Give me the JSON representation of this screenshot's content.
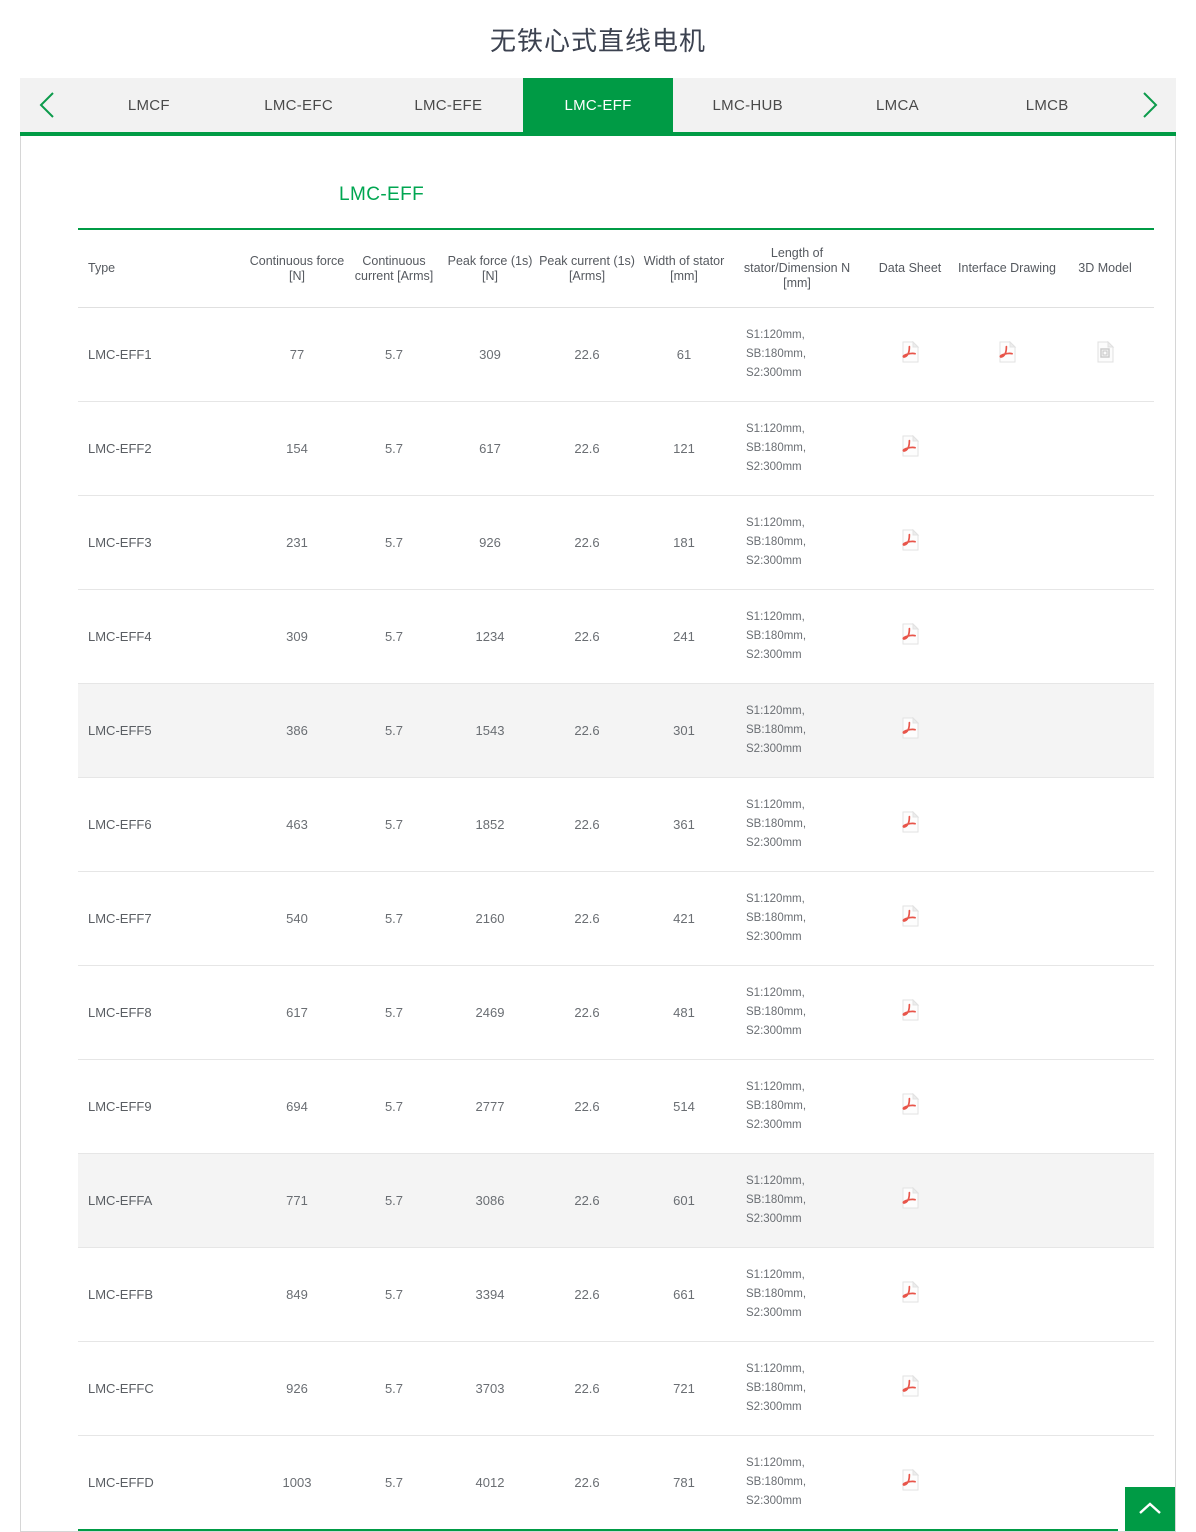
{
  "page": {
    "title": "无铁心式直线电机",
    "accent_color": "#009b45",
    "title_color": "#3c4250"
  },
  "tabs": {
    "prev_label": "‹",
    "next_label": "›",
    "items": [
      {
        "label": "LMCF",
        "active": false
      },
      {
        "label": "LMC-EFC",
        "active": false
      },
      {
        "label": "LMC-EFE",
        "active": false
      },
      {
        "label": "LMC-EFF",
        "active": true
      },
      {
        "label": "LMC-HUB",
        "active": false
      },
      {
        "label": "LMCA",
        "active": false
      },
      {
        "label": "LMCB",
        "active": false
      }
    ]
  },
  "section": {
    "title": "LMC-EFF"
  },
  "table": {
    "headers": [
      "Type",
      "Continuous force [N]",
      "Continuous current [Arms]",
      "Peak force (1s) [N]",
      "Peak current (1s) [Arms]",
      "Width of stator [mm]",
      "Length of stator/Dimension N [mm]",
      "Data Sheet",
      "Interface Drawing",
      "3D Model"
    ],
    "rows": [
      {
        "type": "LMC-EFF1",
        "continuous_force": "77",
        "continuous_current": "5.7",
        "peak_force": "309",
        "peak_current": "22.6",
        "width_of_stator": "61",
        "length_of_stator": "S1:120mm, SB:180mm, S2:300mm",
        "data_sheet": "pdf-icon",
        "interface_drawing": "pdf-icon",
        "model_3d": "model-icon",
        "alt": false
      },
      {
        "type": "LMC-EFF2",
        "continuous_force": "154",
        "continuous_current": "5.7",
        "peak_force": "617",
        "peak_current": "22.6",
        "width_of_stator": "121",
        "length_of_stator": "S1:120mm, SB:180mm, S2:300mm",
        "data_sheet": "pdf-icon",
        "interface_drawing": "",
        "model_3d": "",
        "alt": false
      },
      {
        "type": "LMC-EFF3",
        "continuous_force": "231",
        "continuous_current": "5.7",
        "peak_force": "926",
        "peak_current": "22.6",
        "width_of_stator": "181",
        "length_of_stator": "S1:120mm, SB:180mm, S2:300mm",
        "data_sheet": "pdf-icon",
        "interface_drawing": "",
        "model_3d": "",
        "alt": false
      },
      {
        "type": "LMC-EFF4",
        "continuous_force": "309",
        "continuous_current": "5.7",
        "peak_force": "1234",
        "peak_current": "22.6",
        "width_of_stator": "241",
        "length_of_stator": "S1:120mm, SB:180mm, S2:300mm",
        "data_sheet": "pdf-icon",
        "interface_drawing": "",
        "model_3d": "",
        "alt": false
      },
      {
        "type": "LMC-EFF5",
        "continuous_force": "386",
        "continuous_current": "5.7",
        "peak_force": "1543",
        "peak_current": "22.6",
        "width_of_stator": "301",
        "length_of_stator": "S1:120mm, SB:180mm, S2:300mm",
        "data_sheet": "pdf-icon",
        "interface_drawing": "",
        "model_3d": "",
        "alt": true
      },
      {
        "type": "LMC-EFF6",
        "continuous_force": "463",
        "continuous_current": "5.7",
        "peak_force": "1852",
        "peak_current": "22.6",
        "width_of_stator": "361",
        "length_of_stator": "S1:120mm, SB:180mm, S2:300mm",
        "data_sheet": "pdf-icon",
        "interface_drawing": "",
        "model_3d": "",
        "alt": false
      },
      {
        "type": "LMC-EFF7",
        "continuous_force": "540",
        "continuous_current": "5.7",
        "peak_force": "2160",
        "peak_current": "22.6",
        "width_of_stator": "421",
        "length_of_stator": "S1:120mm, SB:180mm, S2:300mm",
        "data_sheet": "pdf-icon",
        "interface_drawing": "",
        "model_3d": "",
        "alt": false
      },
      {
        "type": "LMC-EFF8",
        "continuous_force": "617",
        "continuous_current": "5.7",
        "peak_force": "2469",
        "peak_current": "22.6",
        "width_of_stator": "481",
        "length_of_stator": "S1:120mm, SB:180mm, S2:300mm",
        "data_sheet": "pdf-icon",
        "interface_drawing": "",
        "model_3d": "",
        "alt": false
      },
      {
        "type": "LMC-EFF9",
        "continuous_force": "694",
        "continuous_current": "5.7",
        "peak_force": "2777",
        "peak_current": "22.6",
        "width_of_stator": "514",
        "length_of_stator": "S1:120mm, SB:180mm, S2:300mm",
        "data_sheet": "pdf-icon",
        "interface_drawing": "",
        "model_3d": "",
        "alt": false
      },
      {
        "type": "LMC-EFFA",
        "continuous_force": "771",
        "continuous_current": "5.7",
        "peak_force": "3086",
        "peak_current": "22.6",
        "width_of_stator": "601",
        "length_of_stator": "S1:120mm, SB:180mm, S2:300mm",
        "data_sheet": "pdf-icon",
        "interface_drawing": "",
        "model_3d": "",
        "alt": true
      },
      {
        "type": "LMC-EFFB",
        "continuous_force": "849",
        "continuous_current": "5.7",
        "peak_force": "3394",
        "peak_current": "22.6",
        "width_of_stator": "661",
        "length_of_stator": "S1:120mm, SB:180mm, S2:300mm",
        "data_sheet": "pdf-icon",
        "interface_drawing": "",
        "model_3d": "",
        "alt": false
      },
      {
        "type": "LMC-EFFC",
        "continuous_force": "926",
        "continuous_current": "5.7",
        "peak_force": "3703",
        "peak_current": "22.6",
        "width_of_stator": "721",
        "length_of_stator": "S1:120mm, SB:180mm, S2:300mm",
        "data_sheet": "pdf-icon",
        "interface_drawing": "",
        "model_3d": "",
        "alt": false
      },
      {
        "type": "LMC-EFFD",
        "continuous_force": "1003",
        "continuous_current": "5.7",
        "peak_force": "4012",
        "peak_current": "22.6",
        "width_of_stator": "781",
        "length_of_stator": "S1:120mm, SB:180mm, S2:300mm",
        "data_sheet": "pdf-icon",
        "interface_drawing": "",
        "model_3d": "",
        "alt": false
      }
    ]
  },
  "back_to_top": {
    "icon": "chevron-up-icon"
  }
}
